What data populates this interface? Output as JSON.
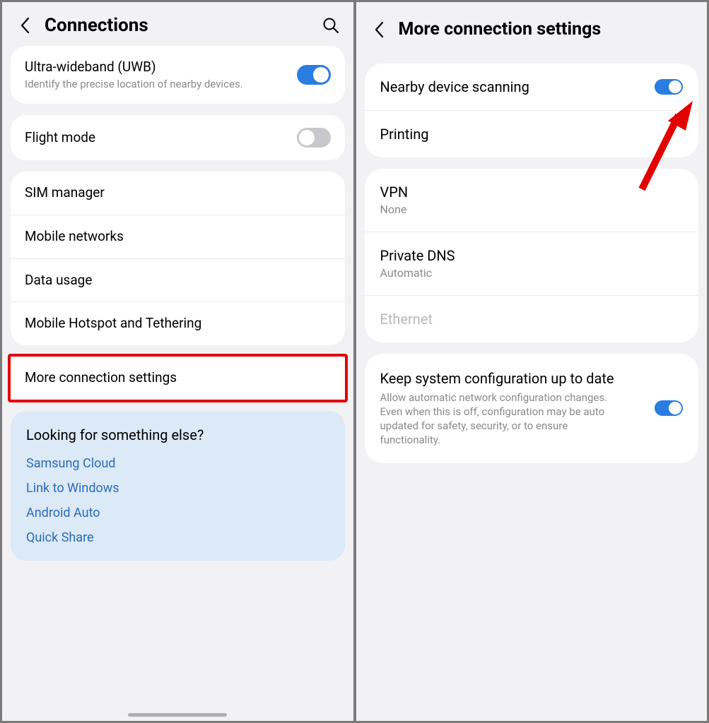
{
  "left": {
    "header_title": "Connections",
    "uwb": {
      "title": "Ultra-wideband (UWB)",
      "subtitle": "Identify the precise location of nearby devices.",
      "toggled": true
    },
    "flight_mode": {
      "title": "Flight mode",
      "toggled": false
    },
    "network_items": [
      "SIM manager",
      "Mobile networks",
      "Data usage",
      "Mobile Hotspot and Tethering"
    ],
    "more_connection": "More connection settings",
    "info": {
      "title": "Looking for something else?",
      "links": [
        "Samsung Cloud",
        "Link to Windows",
        "Android Auto",
        "Quick Share"
      ]
    }
  },
  "right": {
    "header_title": "More connection settings",
    "nearby": {
      "title": "Nearby device scanning",
      "toggled": true
    },
    "printing": "Printing",
    "vpn": {
      "title": "VPN",
      "subtitle": "None"
    },
    "private_dns": {
      "title": "Private DNS",
      "subtitle": "Automatic"
    },
    "ethernet": "Ethernet",
    "keep_config": {
      "title": "Keep system configuration up to date",
      "desc": "Allow automatic network configuration changes. Even when this is off, configuration may be auto updated for safety, security, or to ensure functionality.",
      "toggled": true
    }
  }
}
